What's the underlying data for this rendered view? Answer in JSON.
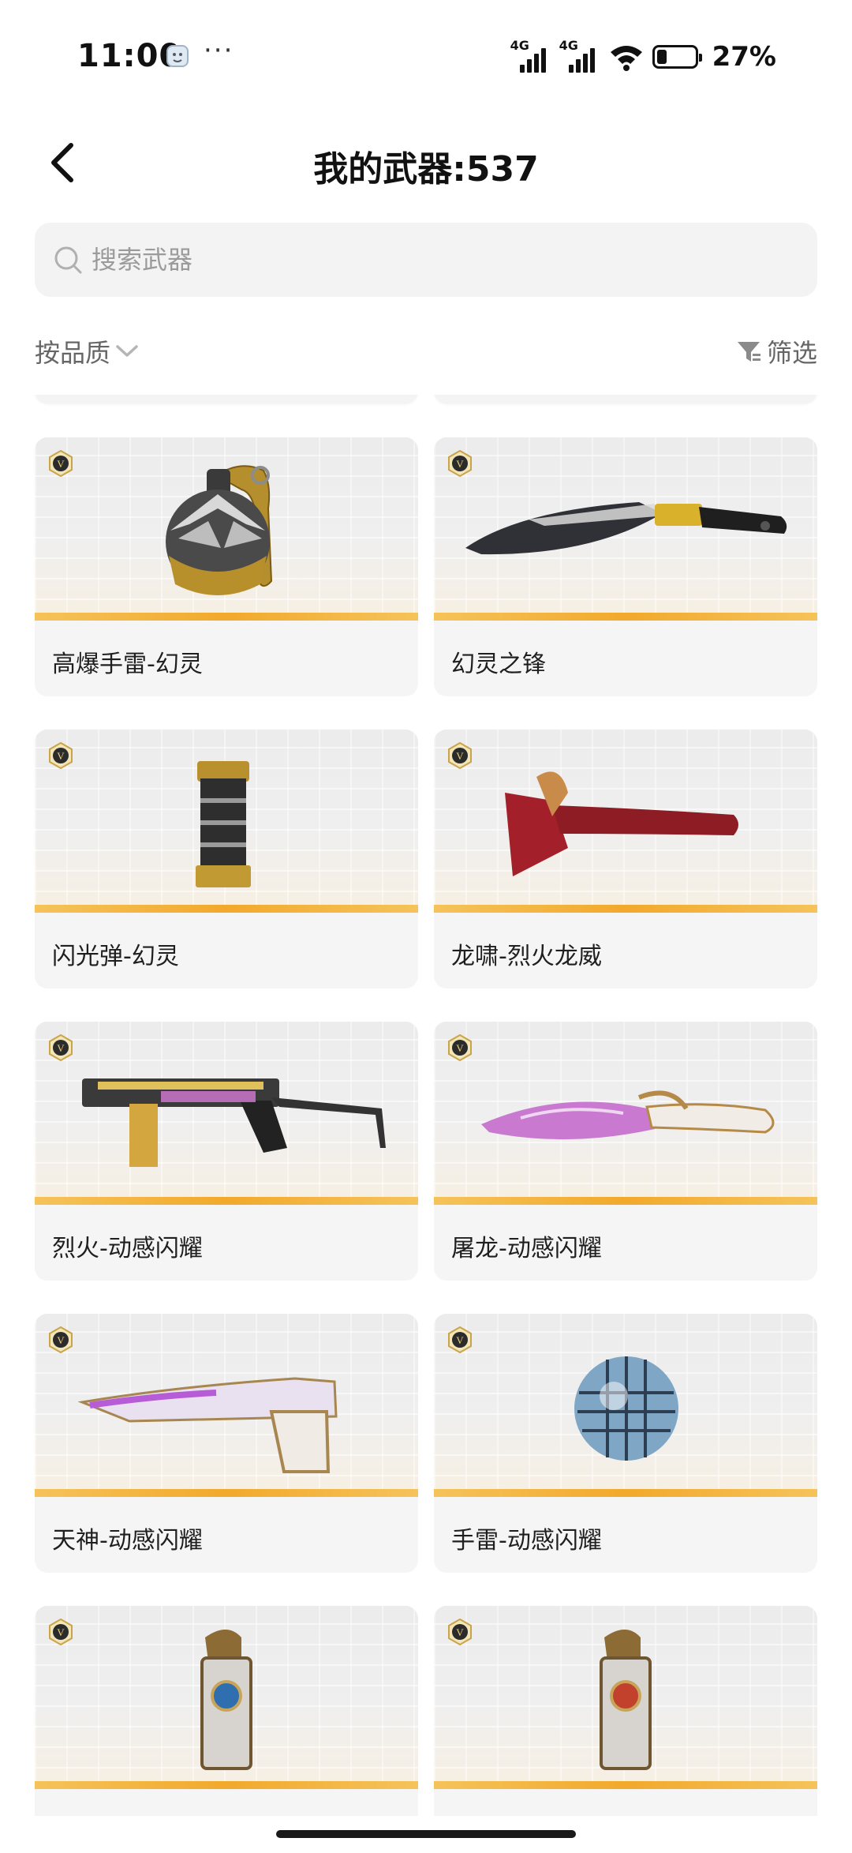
{
  "status_bar": {
    "time": "11:00",
    "more": "···",
    "network_1": "4G",
    "network_2": "4G",
    "battery_percent": "27%",
    "battery_level": 0.27
  },
  "header": {
    "title": "我的武器:537"
  },
  "search": {
    "placeholder": "搜索武器",
    "value": ""
  },
  "controls": {
    "sort_label": "按品质",
    "filter_label": "筛选"
  },
  "colors": {
    "accent_bar": "#f2a92c",
    "card_bg": "#f5f5f5",
    "search_bg": "#f3f3f3"
  },
  "weapons": [
    {
      "name": "高爆手雷-幻灵",
      "icon": "phantom-grenade-icon"
    },
    {
      "name": "幻灵之锋",
      "icon": "phantom-blade-icon"
    },
    {
      "name": "闪光弹-幻灵",
      "icon": "phantom-flashbang-icon"
    },
    {
      "name": "龙啸-烈火龙威",
      "icon": "dragon-axe-icon"
    },
    {
      "name": "烈火-动感闪耀",
      "icon": "smg-icon"
    },
    {
      "name": "屠龙-动感闪耀",
      "icon": "dragon-kukri-icon"
    },
    {
      "name": "天神-动感闪耀",
      "icon": "desert-eagle-icon"
    },
    {
      "name": "手雷-动感闪耀",
      "icon": "disco-grenade-icon"
    },
    {
      "name": "",
      "icon": "dragon-flashbang-icon"
    },
    {
      "name": "",
      "icon": "dragon-flashbang-icon"
    }
  ]
}
